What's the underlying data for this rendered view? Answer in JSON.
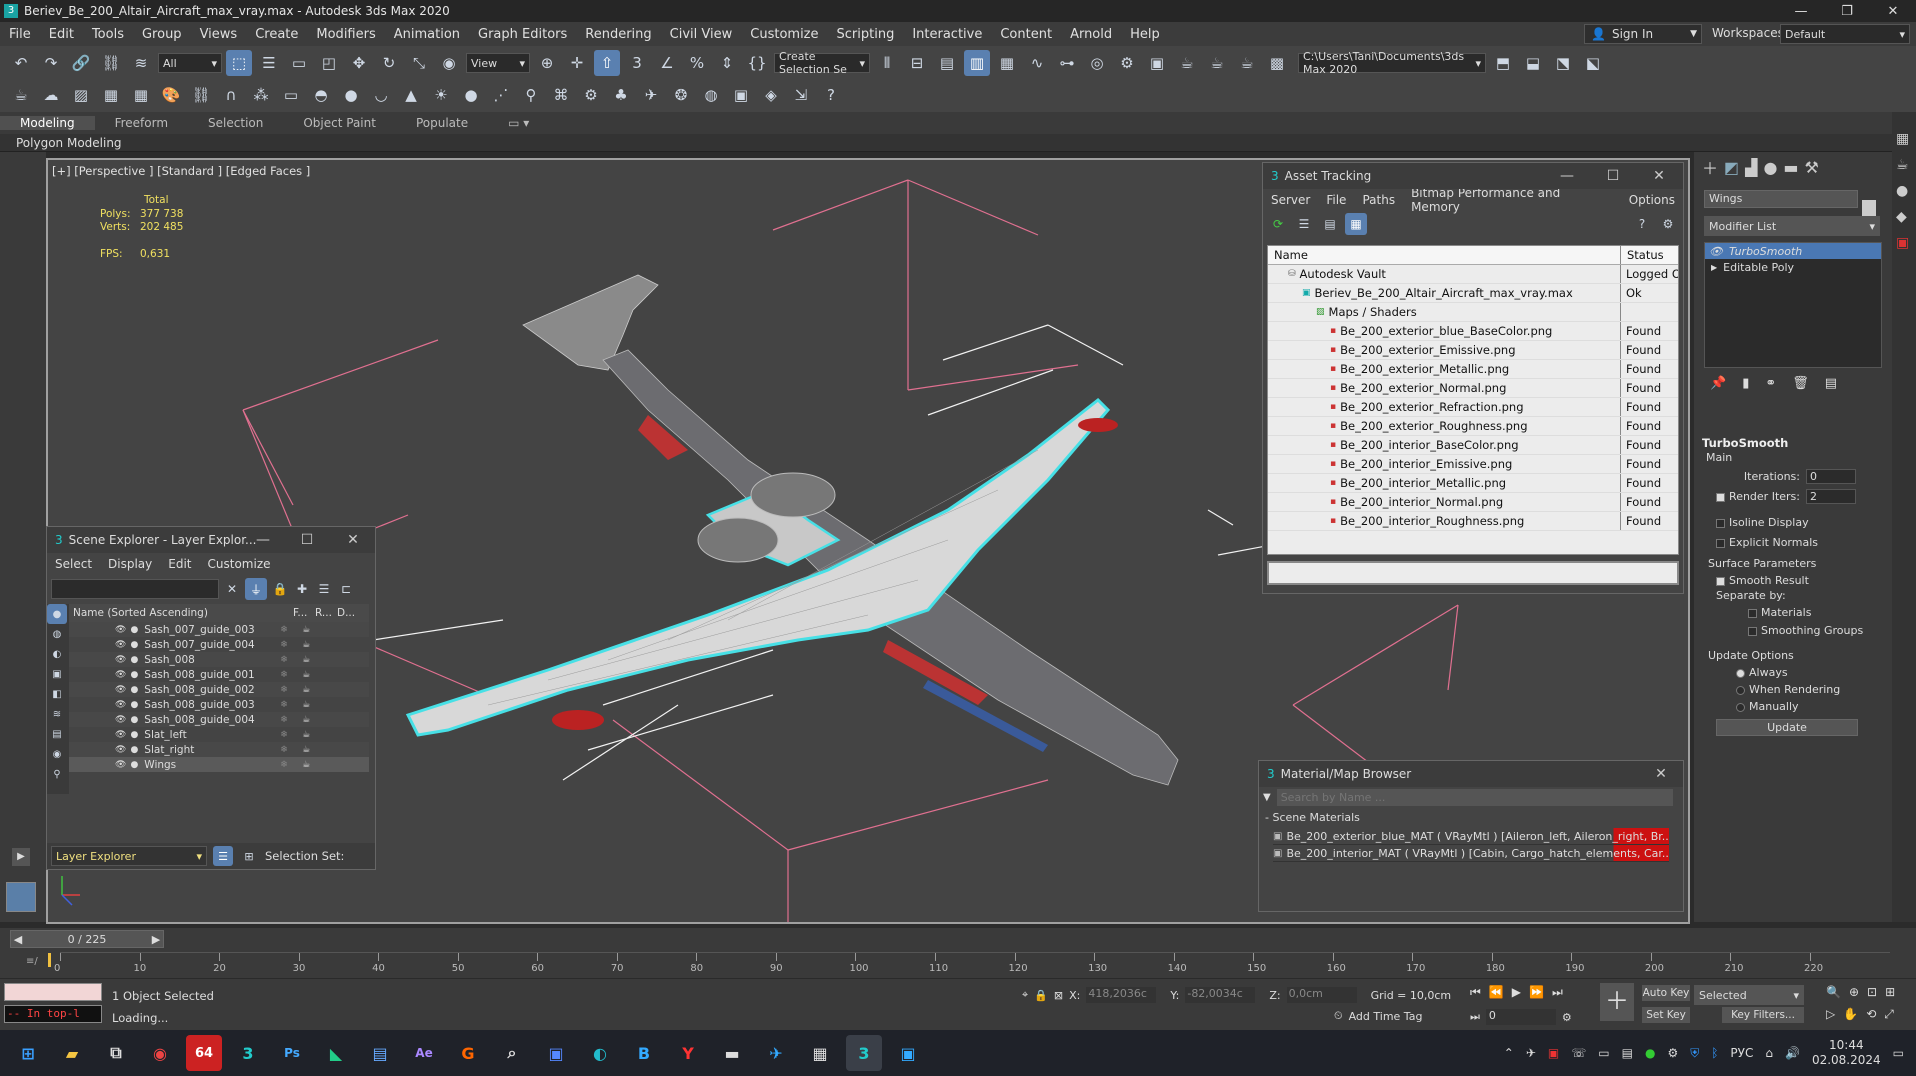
{
  "window": {
    "title": "Beriev_Be_200_Altair_Aircraft_max_vray.max - Autodesk 3ds Max 2020",
    "min": "—",
    "max": "❐",
    "close": "✕"
  },
  "menu": [
    "File",
    "Edit",
    "Tools",
    "Group",
    "Views",
    "Create",
    "Modifiers",
    "Animation",
    "Graph Editors",
    "Rendering",
    "Civil View",
    "Customize",
    "Scripting",
    "Interactive",
    "Content",
    "Arnold",
    "Help"
  ],
  "account": {
    "sign_in": "Sign In",
    "workspaces_label": "Workspaces:",
    "workspace": "Default"
  },
  "toolbar": {
    "selection_filter": "All",
    "ref_coord": "View",
    "create_selection_set": "Create Selection Se",
    "project_path": "C:\\Users\\Tani\\Documents\\3ds Max 2020"
  },
  "ribbon": {
    "tabs": [
      "Modeling",
      "Freeform",
      "Selection",
      "Object Paint",
      "Populate"
    ],
    "sub": "Polygon Modeling"
  },
  "viewport": {
    "label": "[+] [Perspective ] [Standard ] [Edged Faces ]",
    "stats": {
      "total_label": "Total",
      "polys_label": "Polys:",
      "polys": "377 738",
      "verts_label": "Verts:",
      "verts": "202 485",
      "fps_label": "FPS:",
      "fps": "0,631"
    }
  },
  "asset_tracking": {
    "title": "Asset Tracking",
    "menu": [
      "Server",
      "File",
      "Paths",
      "Bitmap Performance and Memory",
      "Options"
    ],
    "col_name": "Name",
    "col_status": "Status",
    "rows": [
      {
        "name": "Autodesk Vault",
        "status": "Logged Ou",
        "indent": 1
      },
      {
        "name": "Beriev_Be_200_Altair_Aircraft_max_vray.max",
        "status": "Ok",
        "indent": 2
      },
      {
        "name": "Maps / Shaders",
        "status": "",
        "indent": 3
      },
      {
        "name": "Be_200_exterior_blue_BaseColor.png",
        "status": "Found",
        "indent": 4
      },
      {
        "name": "Be_200_exterior_Emissive.png",
        "status": "Found",
        "indent": 4
      },
      {
        "name": "Be_200_exterior_Metallic.png",
        "status": "Found",
        "indent": 4
      },
      {
        "name": "Be_200_exterior_Normal.png",
        "status": "Found",
        "indent": 4
      },
      {
        "name": "Be_200_exterior_Refraction.png",
        "status": "Found",
        "indent": 4
      },
      {
        "name": "Be_200_exterior_Roughness.png",
        "status": "Found",
        "indent": 4
      },
      {
        "name": "Be_200_interior_BaseColor.png",
        "status": "Found",
        "indent": 4
      },
      {
        "name": "Be_200_interior_Emissive.png",
        "status": "Found",
        "indent": 4
      },
      {
        "name": "Be_200_interior_Metallic.png",
        "status": "Found",
        "indent": 4
      },
      {
        "name": "Be_200_interior_Normal.png",
        "status": "Found",
        "indent": 4
      },
      {
        "name": "Be_200_interior_Roughness.png",
        "status": "Found",
        "indent": 4
      }
    ]
  },
  "scene_explorer": {
    "title": "Scene Explorer - Layer Explor...",
    "menu": [
      "Select",
      "Display",
      "Edit",
      "Customize"
    ],
    "col_name": "Name (Sorted Ascending)",
    "col_f": "F...",
    "col_r": "R...",
    "col_d": "D...",
    "rows": [
      "Sash_007_guide_003",
      "Sash_007_guide_004",
      "Sash_008",
      "Sash_008_guide_001",
      "Sash_008_guide_002",
      "Sash_008_guide_003",
      "Sash_008_guide_004",
      "Slat_left",
      "Slat_right",
      "Wings"
    ],
    "footer_combo": "Layer Explorer",
    "selection_set_label": "Selection Set:"
  },
  "material_browser": {
    "title": "Material/Map Browser",
    "search_placeholder": "Search by Name ...",
    "section": "- Scene Materials",
    "items": [
      "Be_200_exterior_blue_MAT ( VRayMtl ) [Aileron_left, Aileron_right, Br...",
      "Be_200_interior_MAT ( VRayMtl ) [Cabin, Cargo_hatch_elements, Car..."
    ]
  },
  "command_panel": {
    "object_name": "Wings",
    "modifier_list": "Modifier List",
    "stack": [
      "TurboSmooth",
      "Editable Poly"
    ],
    "rollout_title": "TurboSmooth",
    "main_label": "Main",
    "iterations_label": "Iterations:",
    "iterations": "0",
    "render_iters_label": "Render Iters:",
    "render_iters": "2",
    "isoline": "Isoline Display",
    "explicit_normals": "Explicit Normals",
    "surface_params": "Surface Parameters",
    "smooth_result": "Smooth Result",
    "separate_by": "Separate by:",
    "materials": "Materials",
    "smoothing_groups": "Smoothing Groups",
    "update_options": "Update Options",
    "always": "Always",
    "when_rendering": "When Rendering",
    "manually": "Manually",
    "update_btn": "Update"
  },
  "timeline": {
    "frame": "0 / 225",
    "ticks": [
      "0",
      "10",
      "20",
      "30",
      "40",
      "50",
      "60",
      "70",
      "80",
      "90",
      "100",
      "110",
      "120",
      "130",
      "140",
      "150",
      "160",
      "170",
      "180",
      "190",
      "200",
      "210",
      "220"
    ]
  },
  "status": {
    "selected": "1 Object Selected",
    "loading": "Loading...",
    "maxscript": "-- In top-l",
    "x_label": "X:",
    "x": "418,2036c",
    "y_label": "Y:",
    "y": "-82,0034c",
    "z_label": "Z:",
    "z": "0,0cm",
    "grid": "Grid = 10,0cm",
    "add_time_tag": "Add Time Tag",
    "auto_key": "Auto Key",
    "set_key": "Set Key",
    "selected_combo": "Selected",
    "key_filters": "Key Filters...",
    "frame_field": "0"
  },
  "taskbar": {
    "lang": "РУС",
    "time": "10:44",
    "date": "02.08.2024",
    "badge": "64"
  }
}
